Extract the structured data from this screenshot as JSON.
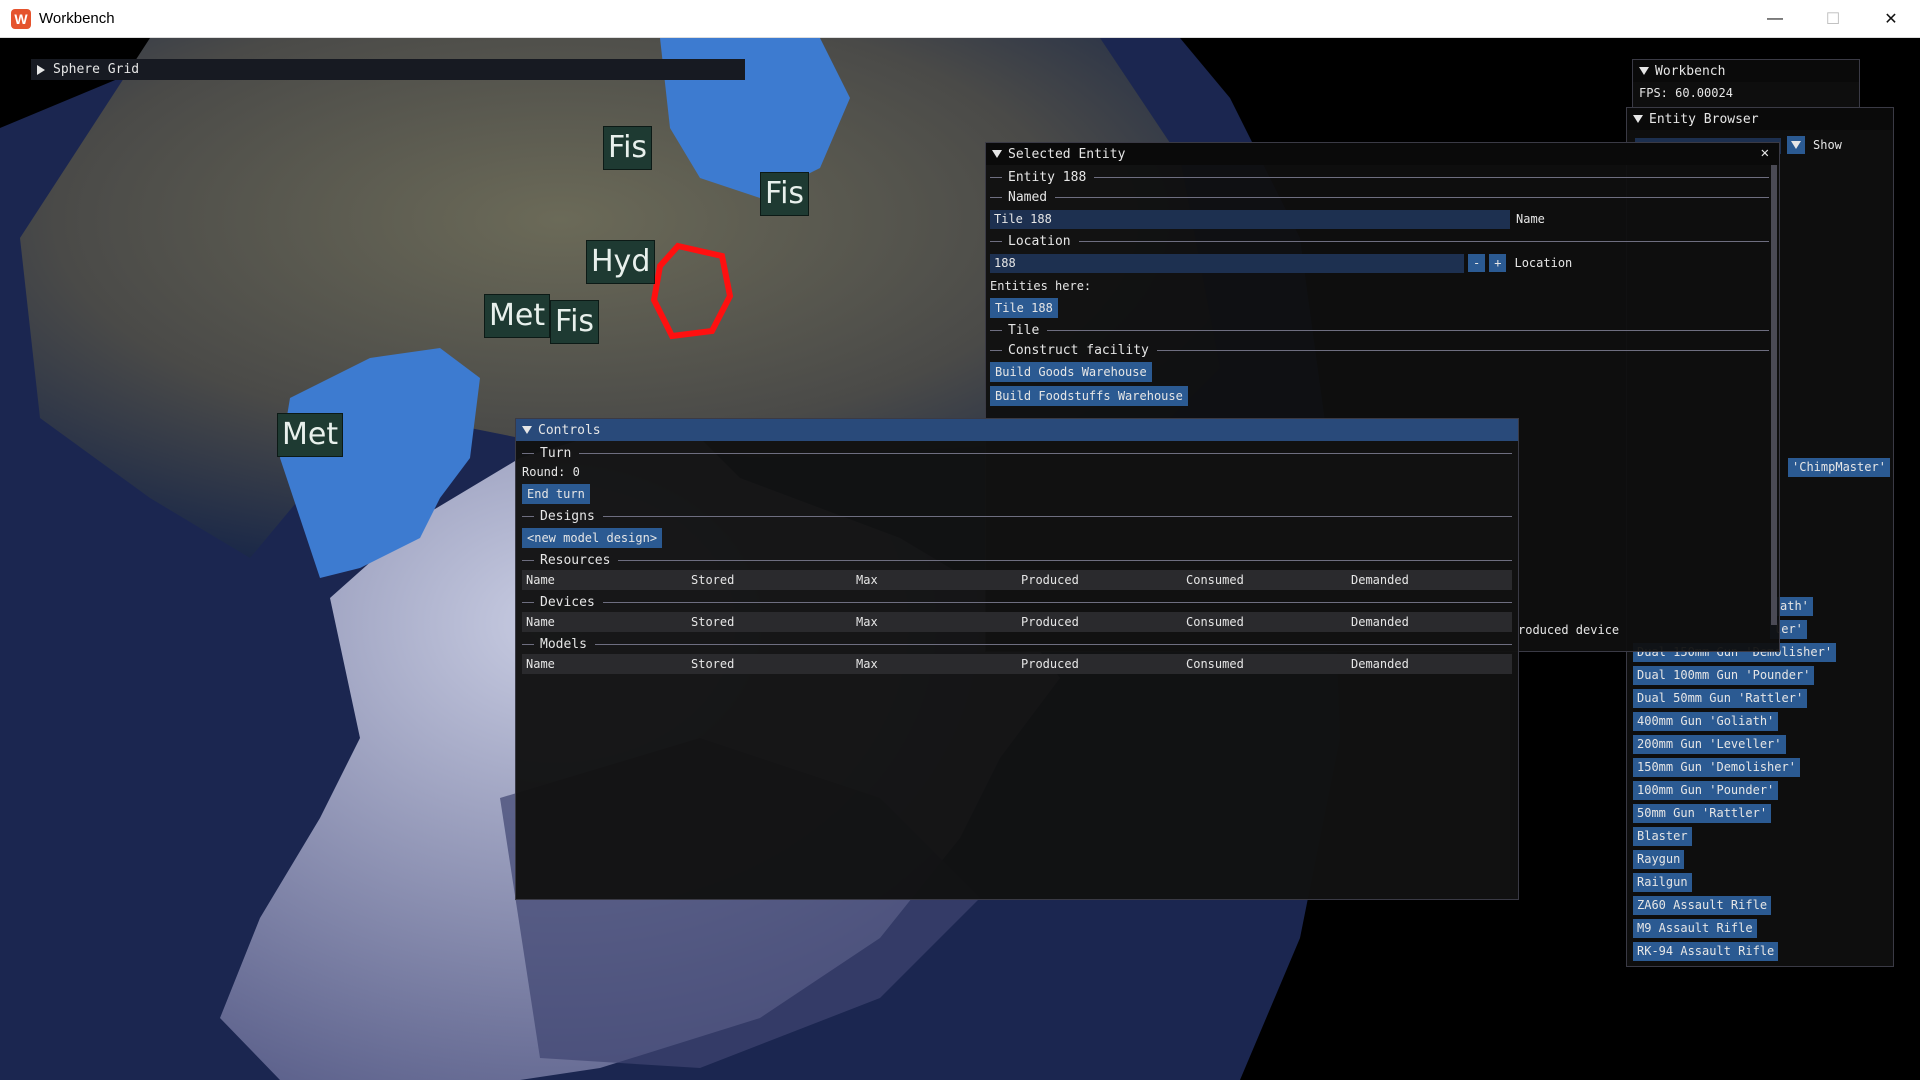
{
  "window": {
    "title": "Workbench",
    "icon": "app-logo-icon",
    "minimize": "—",
    "maximize": "☐",
    "close": "✕"
  },
  "map": {
    "labels": [
      "Fis",
      "Fis",
      "Hyd",
      "Met",
      "Fis",
      "Met"
    ],
    "colors": {
      "space": "#000000",
      "land": "#5a5a4e",
      "water": "#3d7bd0",
      "ice": "#a8aed0",
      "selection": "#ff1010"
    }
  },
  "sphere_grid": {
    "title": "Sphere Grid"
  },
  "workbench": {
    "title": "Workbench",
    "fps": "FPS: 60.00024"
  },
  "entity_browser": {
    "title": "Entity Browser",
    "show_label": "Show",
    "items": [
      "Dual 100mm Gun 'Pounder'",
      "Dual 50mm Gun 'Rattler'",
      "400mm Gun 'Goliath'",
      "200mm Gun 'Leveller'",
      "150mm Gun 'Demolisher'",
      "100mm Gun 'Pounder'",
      "50mm Gun 'Rattler'",
      "Blaster",
      "Raygun",
      "Railgun",
      "ZA60 Assault Rifle",
      "M9 Assault Rifle",
      "RK-94 Assault Rifle"
    ],
    "partial_items": [
      "'ChimpMaster'",
      "ath'",
      "ler'",
      "Dual 150mm Gun 'Demolisher'"
    ]
  },
  "selected_entity": {
    "title": "Selected Entity",
    "entity_header": "Entity 188",
    "named_header": "Named",
    "name_value": "Tile 188",
    "name_label": "Name",
    "location_header": "Location",
    "location_value": "188",
    "minus": "-",
    "plus": "+",
    "location_label": "Location",
    "entities_here_label": "Entities here:",
    "entities_here": [
      "Tile 188"
    ],
    "tile_header": "Tile",
    "construct_header": "Construct facility",
    "build_buttons": [
      "Build Goods Warehouse",
      "Build Foodstuffs Warehouse"
    ],
    "produced_device": "roduced device"
  },
  "controls": {
    "title": "Controls",
    "turn_header": "Turn",
    "round": "Round: 0",
    "end_turn": "End turn",
    "designs_header": "Designs",
    "new_model": "<new model design>",
    "resources_header": "Resources",
    "devices_header": "Devices",
    "models_header": "Models",
    "columns": [
      "Name",
      "Stored",
      "Max",
      "Produced",
      "Consumed",
      "Demanded"
    ]
  }
}
